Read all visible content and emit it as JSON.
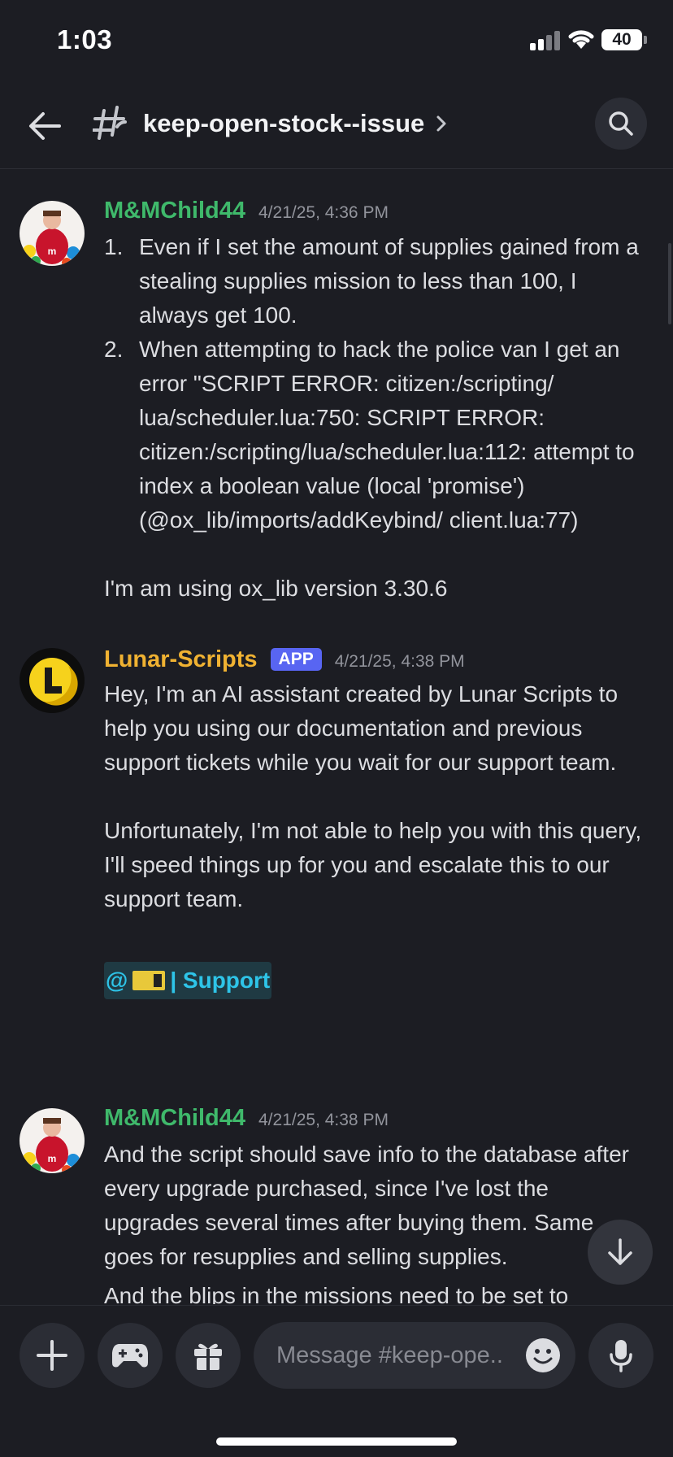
{
  "status_bar": {
    "time": "1:03",
    "battery": "40"
  },
  "header": {
    "channel_name": "keep-open-stock--issue"
  },
  "messages": [
    {
      "author": "M&MChild44",
      "timestamp": "4/21/25, 4:36 PM",
      "list": [
        {
          "num": "1.",
          "text": "Even if I set the amount of supplies gained from a stealing supplies mission to less than 100, I always get 100."
        },
        {
          "num": "2.",
          "text": "When attempting to hack the police van I get an error \"SCRIPT ERROR: citizen:/scripting/ lua/scheduler.lua:750: SCRIPT ERROR: citizen:/scripting/lua/scheduler.lua:112: attempt to index a boolean value (local 'promise') (@ox_lib/imports/addKeybind/ client.lua:77)"
        }
      ],
      "footer": "I'm am using ox_lib version 3.30.6"
    },
    {
      "author": "Lunar-Scripts",
      "badge": "APP",
      "timestamp": "4/21/25, 4:38 PM",
      "para1": "Hey, I'm an AI assistant created by Lunar Scripts to help you using our documentation and previous support tickets while you wait for our support team.",
      "para2": "Unfortunately, I'm not able to help you with this query, I'll speed things up for you and escalate this to our support team.",
      "mention_prefix": "@",
      "mention_label": "| Support"
    },
    {
      "author": "M&MChild44",
      "timestamp": "4/21/25, 4:38 PM",
      "para1": "And the script should save info to the database after every upgrade purchased, since I've lost the upgrades several times after buying them. Same goes for resupplies and selling supplies.",
      "para2": "And the blips in the missions need to be set to"
    }
  ],
  "composer": {
    "placeholder": "Message #keep-ope.."
  },
  "colors": {
    "background": "#1c1d23",
    "user_green": "#3fb96b",
    "bot_yellow": "#f0b232",
    "app_badge": "#5865f2",
    "mention": "#2ec4e8"
  },
  "icons": [
    "back-arrow-icon",
    "thread-icon",
    "chevron-right-icon",
    "search-icon",
    "plus-icon",
    "gamepad-icon",
    "gift-icon",
    "emoji-icon",
    "microphone-icon",
    "arrow-down-icon"
  ]
}
